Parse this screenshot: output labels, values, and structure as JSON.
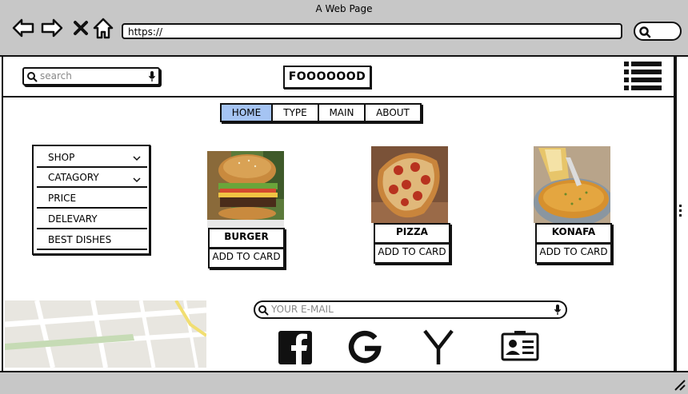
{
  "window": {
    "title": "A Web Page"
  },
  "browser": {
    "url": "https://"
  },
  "header": {
    "search_placeholder": "search",
    "logo": "FOOOOOOD"
  },
  "tabs": [
    {
      "label": "HOME",
      "active": true
    },
    {
      "label": "TYPE",
      "active": false
    },
    {
      "label": "MAIN",
      "active": false
    },
    {
      "label": "ABOUT",
      "active": false
    }
  ],
  "sidebar": {
    "items": [
      {
        "label": "SHOP",
        "has_dropdown": true
      },
      {
        "label": "CATAGORY",
        "has_dropdown": true
      },
      {
        "label": "PRICE",
        "has_dropdown": false
      },
      {
        "label": "DELEVARY",
        "has_dropdown": false
      },
      {
        "label": "BEST DISHES",
        "has_dropdown": false
      }
    ]
  },
  "foods": [
    {
      "name": "BURGER",
      "button": "ADD TO CARD",
      "image": "burger-image"
    },
    {
      "name": "PIZZA",
      "button": "ADD TO CARD",
      "image": "pizza-image"
    },
    {
      "name": "KONAFA",
      "button": "ADD TO CARD",
      "image": "konafa-image"
    }
  ],
  "footer": {
    "email_placeholder": "YOUR E-MAIL",
    "social": [
      "facebook-icon",
      "google-icon",
      "yahoo-icon",
      "contact-card-icon"
    ]
  },
  "colors": {
    "active_tab": "#a5c4f3",
    "chrome": "#c7c7c7"
  }
}
